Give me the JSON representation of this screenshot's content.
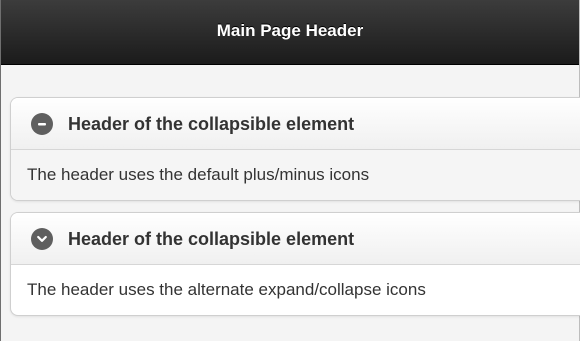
{
  "header": {
    "title": "Main Page Header"
  },
  "collapsibles": [
    {
      "title": "Header of the collapsible element",
      "body": "The header uses the default plus/minus icons",
      "icon": "minus-icon"
    },
    {
      "title": "Header of the collapsible element",
      "body": "The header uses the alternate expand/collapse icons",
      "icon": "chevron-down-icon"
    }
  ],
  "colors": {
    "header_bg": "#1b1b1b",
    "icon_bg": "#5f5f5f",
    "text": "#333333"
  }
}
